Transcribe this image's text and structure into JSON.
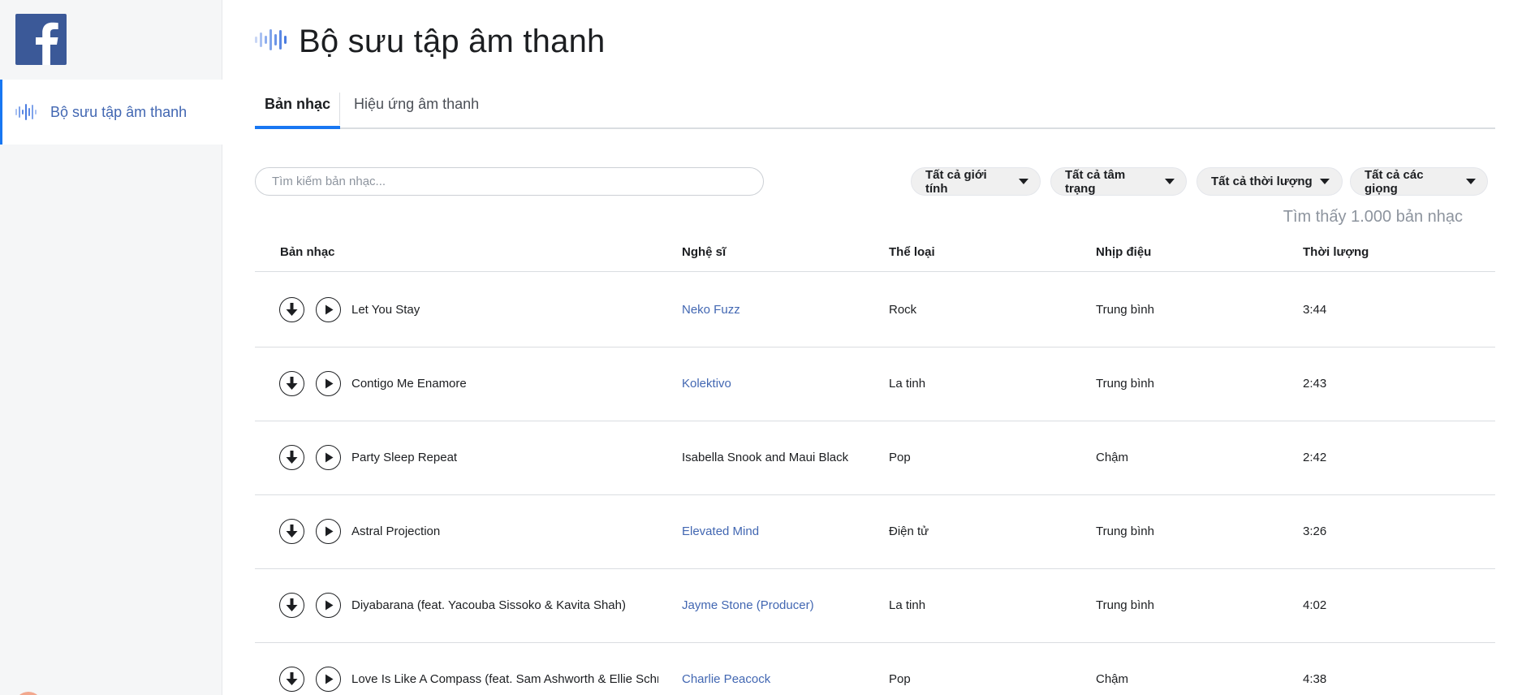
{
  "sidebar": {
    "logo": "facebook-logo",
    "items": [
      {
        "label": "Bộ sưu tập âm thanh",
        "icon": "sound-wave-icon",
        "active": true
      }
    ]
  },
  "header": {
    "title": "Bộ sưu tập âm thanh",
    "icon": "sound-wave-icon"
  },
  "tabs": [
    {
      "label": "Bản nhạc",
      "active": true
    },
    {
      "label": "Hiệu ứng âm thanh",
      "active": false
    }
  ],
  "search": {
    "placeholder": "Tìm kiếm bản nhạc...",
    "value": ""
  },
  "filters": [
    {
      "label": "Tất cả giới tính"
    },
    {
      "label": "Tất cả tâm trạng"
    },
    {
      "label": "Tất cả thời lượng"
    },
    {
      "label": "Tất cả các giọng"
    }
  ],
  "result_count": "Tìm thấy 1.000 bản nhạc",
  "table": {
    "columns": [
      "Bản nhạc",
      "Nghệ sĩ",
      "Thể loại",
      "Nhịp điệu",
      "Thời lượng"
    ],
    "rows": [
      {
        "track": "Let You Stay",
        "artist": "Neko Fuzz",
        "artist_link": true,
        "genre": "Rock",
        "tempo": "Trung bình",
        "duration": "3:44"
      },
      {
        "track": "Contigo Me Enamore",
        "artist": "Kolektivo",
        "artist_link": true,
        "genre": "La tinh",
        "tempo": "Trung bình",
        "duration": "2:43"
      },
      {
        "track": "Party Sleep Repeat",
        "artist": "Isabella Snook and Maui Black",
        "artist_link": false,
        "genre": "Pop",
        "tempo": "Chậm",
        "duration": "2:42"
      },
      {
        "track": "Astral Projection",
        "artist": "Elevated Mind",
        "artist_link": true,
        "genre": "Điện tử",
        "tempo": "Trung bình",
        "duration": "3:26"
      },
      {
        "track": "Diyabarana (feat. Yacouba Sissoko & Kavita Shah)",
        "artist": "Jayme Stone (Producer)",
        "artist_link": true,
        "genre": "La tinh",
        "tempo": "Trung bình",
        "duration": "4:02"
      },
      {
        "track": "Love Is Like A Compass (feat. Sam Ashworth & Ellie Schmidt)",
        "artist": "Charlie Peacock",
        "artist_link": true,
        "genre": "Pop",
        "tempo": "Chậm",
        "duration": "4:38"
      }
    ]
  },
  "colors": {
    "accent": "#1877f2",
    "link": "#4267b2",
    "facebook_blue": "#3b5998",
    "sidebar_bg": "#f5f6f7",
    "muted_text": "#8d949e"
  }
}
